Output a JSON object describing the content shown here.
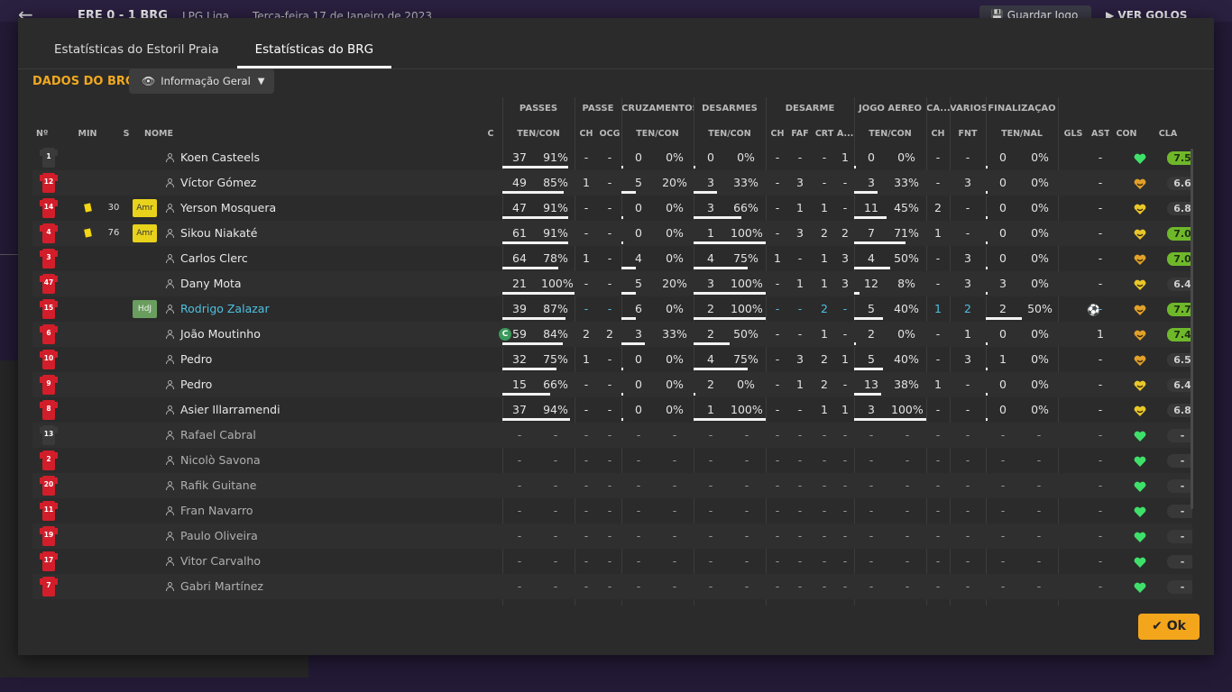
{
  "topbar": {
    "score": "ERE 0 - 1 BRG",
    "league": "LPG Liga",
    "date": "Terça-feira 17 de Janeiro de 2023",
    "save_label": "Guardar Jogo",
    "goals_label": "VER GOLOS"
  },
  "tabs": [
    {
      "label": "Estatísticas do Estoril Praia"
    },
    {
      "label": "Estatísticas do BRG"
    }
  ],
  "section_title": "DADOS DO BRG",
  "view_dropdown": {
    "label": "Informação Geral"
  },
  "groups": {
    "passes": "PASSES",
    "passe": "PASSE",
    "cruzamentos": "CRUZAMENTOS",
    "desarmes": "DESARMES",
    "desarme": "DESARME",
    "jogo_aereo": "JOGO AÉREO",
    "ca": "CA...",
    "varios": "VÁRIOS",
    "finalizacao": "FINALIZAÇÃO"
  },
  "columns": {
    "no": "Nº",
    "min": "MIN",
    "s": "S",
    "nome": "NOME",
    "c": "C",
    "passes_tc": "TEN/CON",
    "passe_ch": "CH",
    "passe_ocg": "OCG",
    "cruz_tc": "TEN/CON",
    "des_tc": "TEN/CON",
    "dsm_ch": "CH",
    "dsm_faf": "FAF",
    "dsm_crt": "CRT",
    "dsm_a": "A...",
    "aer_tc": "TEN/CON",
    "ca_ch": "CH",
    "var_fnt": "FNT",
    "fin_tn": "TEN/NAL",
    "gls": "GLS",
    "ast": "AST",
    "con": "CON",
    "cla": "CLA"
  },
  "players": [
    {
      "num": "1",
      "gk": true,
      "min": "",
      "card": false,
      "badge": "",
      "name": "Koen Casteels",
      "captain": false,
      "p_ten": "37",
      "p_pct": "91%",
      "p_ch": "-",
      "p_ocg": "-",
      "cr_ten": "0",
      "cr_pct": "0%",
      "de_ten": "0",
      "de_pct": "0%",
      "ds_ch": "-",
      "ds_faf": "-",
      "ds_crt": "-",
      "ds_a": "1",
      "ae_ten": "0",
      "ae_pct": "0%",
      "ca_ch": "-",
      "va_fnt": "-",
      "fi_ten": "0",
      "fi_pct": "0%",
      "gls": "",
      "ast": "-",
      "morale": "green",
      "rating": "7.5"
    },
    {
      "num": "12",
      "gk": false,
      "min": "",
      "card": false,
      "badge": "",
      "name": "Víctor Gómez",
      "captain": false,
      "p_ten": "49",
      "p_pct": "85%",
      "p_ch": "1",
      "p_ocg": "-",
      "cr_ten": "5",
      "cr_pct": "20%",
      "de_ten": "3",
      "de_pct": "33%",
      "ds_ch": "-",
      "ds_faf": "3",
      "ds_crt": "-",
      "ds_a": "-",
      "ae_ten": "3",
      "ae_pct": "33%",
      "ca_ch": "-",
      "va_fnt": "3",
      "fi_ten": "0",
      "fi_pct": "0%",
      "gls": "",
      "ast": "-",
      "morale": "orange",
      "rating": "6.6"
    },
    {
      "num": "14",
      "gk": false,
      "min": "30",
      "card": true,
      "badge": "Amr",
      "name": "Yerson Mosquera",
      "captain": false,
      "p_ten": "47",
      "p_pct": "91%",
      "p_ch": "-",
      "p_ocg": "-",
      "cr_ten": "0",
      "cr_pct": "0%",
      "de_ten": "3",
      "de_pct": "66%",
      "ds_ch": "-",
      "ds_faf": "1",
      "ds_crt": "1",
      "ds_a": "-",
      "ae_ten": "11",
      "ae_pct": "45%",
      "ca_ch": "2",
      "va_fnt": "-",
      "fi_ten": "0",
      "fi_pct": "0%",
      "gls": "",
      "ast": "-",
      "morale": "yellow",
      "rating": "6.8"
    },
    {
      "num": "4",
      "gk": false,
      "min": "76",
      "card": true,
      "badge": "Amr",
      "name": "Sikou Niakaté",
      "captain": false,
      "p_ten": "61",
      "p_pct": "91%",
      "p_ch": "-",
      "p_ocg": "-",
      "cr_ten": "0",
      "cr_pct": "0%",
      "de_ten": "1",
      "de_pct": "100%",
      "ds_ch": "-",
      "ds_faf": "3",
      "ds_crt": "2",
      "ds_a": "2",
      "ae_ten": "7",
      "ae_pct": "71%",
      "ca_ch": "1",
      "va_fnt": "-",
      "fi_ten": "0",
      "fi_pct": "0%",
      "gls": "",
      "ast": "-",
      "morale": "yellow",
      "rating": "7.0"
    },
    {
      "num": "3",
      "gk": false,
      "min": "",
      "card": false,
      "badge": "",
      "name": "Carlos Clerc",
      "captain": false,
      "p_ten": "64",
      "p_pct": "78%",
      "p_ch": "1",
      "p_ocg": "-",
      "cr_ten": "4",
      "cr_pct": "0%",
      "de_ten": "4",
      "de_pct": "75%",
      "ds_ch": "1",
      "ds_faf": "-",
      "ds_crt": "1",
      "ds_a": "3",
      "ae_ten": "4",
      "ae_pct": "50%",
      "ca_ch": "-",
      "va_fnt": "3",
      "fi_ten": "0",
      "fi_pct": "0%",
      "gls": "",
      "ast": "-",
      "morale": "orange",
      "rating": "7.0"
    },
    {
      "num": "47",
      "gk": false,
      "min": "",
      "card": false,
      "badge": "",
      "name": "Dany Mota",
      "captain": false,
      "p_ten": "21",
      "p_pct": "100%",
      "p_ch": "-",
      "p_ocg": "-",
      "cr_ten": "5",
      "cr_pct": "20%",
      "de_ten": "3",
      "de_pct": "100%",
      "ds_ch": "-",
      "ds_faf": "1",
      "ds_crt": "1",
      "ds_a": "3",
      "ae_ten": "12",
      "ae_pct": "8%",
      "ca_ch": "-",
      "va_fnt": "3",
      "fi_ten": "3",
      "fi_pct": "0%",
      "gls": "",
      "ast": "-",
      "morale": "yellow",
      "rating": "6.4"
    },
    {
      "num": "15",
      "gk": false,
      "min": "",
      "card": false,
      "badge": "HdJ",
      "name": "Rodrigo Zalazar",
      "captain": false,
      "highlight": true,
      "p_ten": "39",
      "p_pct": "87%",
      "p_ch": "-",
      "p_ocg": "-",
      "cr_ten": "6",
      "cr_pct": "0%",
      "de_ten": "2",
      "de_pct": "100%",
      "ds_ch": "-",
      "ds_faf": "-",
      "ds_crt": "2",
      "ds_a": "-",
      "ae_ten": "5",
      "ae_pct": "40%",
      "ca_ch": "1",
      "va_fnt": "2",
      "fi_ten": "2",
      "fi_pct": "50%",
      "gls": "ball",
      "ast": "-",
      "morale": "orange",
      "rating": "7.7"
    },
    {
      "num": "6",
      "gk": false,
      "min": "",
      "card": false,
      "badge": "",
      "name": "João Moutinho",
      "captain": true,
      "p_ten": "59",
      "p_pct": "84%",
      "p_ch": "2",
      "p_ocg": "2",
      "cr_ten": "3",
      "cr_pct": "33%",
      "de_ten": "2",
      "de_pct": "50%",
      "ds_ch": "-",
      "ds_faf": "-",
      "ds_crt": "1",
      "ds_a": "-",
      "ae_ten": "2",
      "ae_pct": "0%",
      "ca_ch": "-",
      "va_fnt": "1",
      "fi_ten": "0",
      "fi_pct": "0%",
      "gls": "",
      "ast": "1",
      "morale": "orange",
      "rating": "7.4"
    },
    {
      "num": "10",
      "gk": false,
      "min": "",
      "card": false,
      "badge": "",
      "name": "Pedro",
      "captain": false,
      "p_ten": "32",
      "p_pct": "75%",
      "p_ch": "1",
      "p_ocg": "-",
      "cr_ten": "0",
      "cr_pct": "0%",
      "de_ten": "4",
      "de_pct": "75%",
      "ds_ch": "-",
      "ds_faf": "3",
      "ds_crt": "2",
      "ds_a": "1",
      "ae_ten": "5",
      "ae_pct": "40%",
      "ca_ch": "-",
      "va_fnt": "3",
      "fi_ten": "1",
      "fi_pct": "0%",
      "gls": "",
      "ast": "-",
      "morale": "orange",
      "rating": "6.5"
    },
    {
      "num": "9",
      "gk": false,
      "min": "",
      "card": false,
      "badge": "",
      "name": "Pedro",
      "captain": false,
      "p_ten": "15",
      "p_pct": "66%",
      "p_ch": "-",
      "p_ocg": "-",
      "cr_ten": "0",
      "cr_pct": "0%",
      "de_ten": "2",
      "de_pct": "0%",
      "ds_ch": "-",
      "ds_faf": "1",
      "ds_crt": "2",
      "ds_a": "-",
      "ae_ten": "13",
      "ae_pct": "38%",
      "ca_ch": "1",
      "va_fnt": "-",
      "fi_ten": "0",
      "fi_pct": "0%",
      "gls": "",
      "ast": "-",
      "morale": "yellow",
      "rating": "6.4"
    },
    {
      "num": "8",
      "gk": false,
      "min": "",
      "card": false,
      "badge": "",
      "name": "Asier Illarramendi",
      "captain": false,
      "p_ten": "37",
      "p_pct": "94%",
      "p_ch": "-",
      "p_ocg": "-",
      "cr_ten": "0",
      "cr_pct": "0%",
      "de_ten": "1",
      "de_pct": "100%",
      "ds_ch": "-",
      "ds_faf": "-",
      "ds_crt": "1",
      "ds_a": "1",
      "ae_ten": "3",
      "ae_pct": "100%",
      "ca_ch": "-",
      "va_fnt": "-",
      "fi_ten": "0",
      "fi_pct": "0%",
      "gls": "",
      "ast": "-",
      "morale": "yellow",
      "rating": "6.8"
    },
    {
      "num": "13",
      "gk": true,
      "sub": true,
      "name": "Rafael Cabral"
    },
    {
      "num": "2",
      "gk": false,
      "sub": true,
      "name": "Nicolò Savona"
    },
    {
      "num": "20",
      "gk": false,
      "sub": true,
      "name": "Rafik Guitane"
    },
    {
      "num": "11",
      "gk": false,
      "sub": true,
      "name": "Fran Navarro"
    },
    {
      "num": "19",
      "gk": false,
      "sub": true,
      "name": "Paulo Oliveira"
    },
    {
      "num": "17",
      "gk": false,
      "sub": true,
      "name": "Vitor Carvalho"
    },
    {
      "num": "7",
      "gk": false,
      "sub": true,
      "name": "Gabri Martínez"
    }
  ],
  "ok_label": "Ok",
  "colors": {
    "accent": "#f0a820",
    "ok": "#f3a51c",
    "rating_good": "#6fb82a",
    "highlight": "#4ec0e0"
  }
}
